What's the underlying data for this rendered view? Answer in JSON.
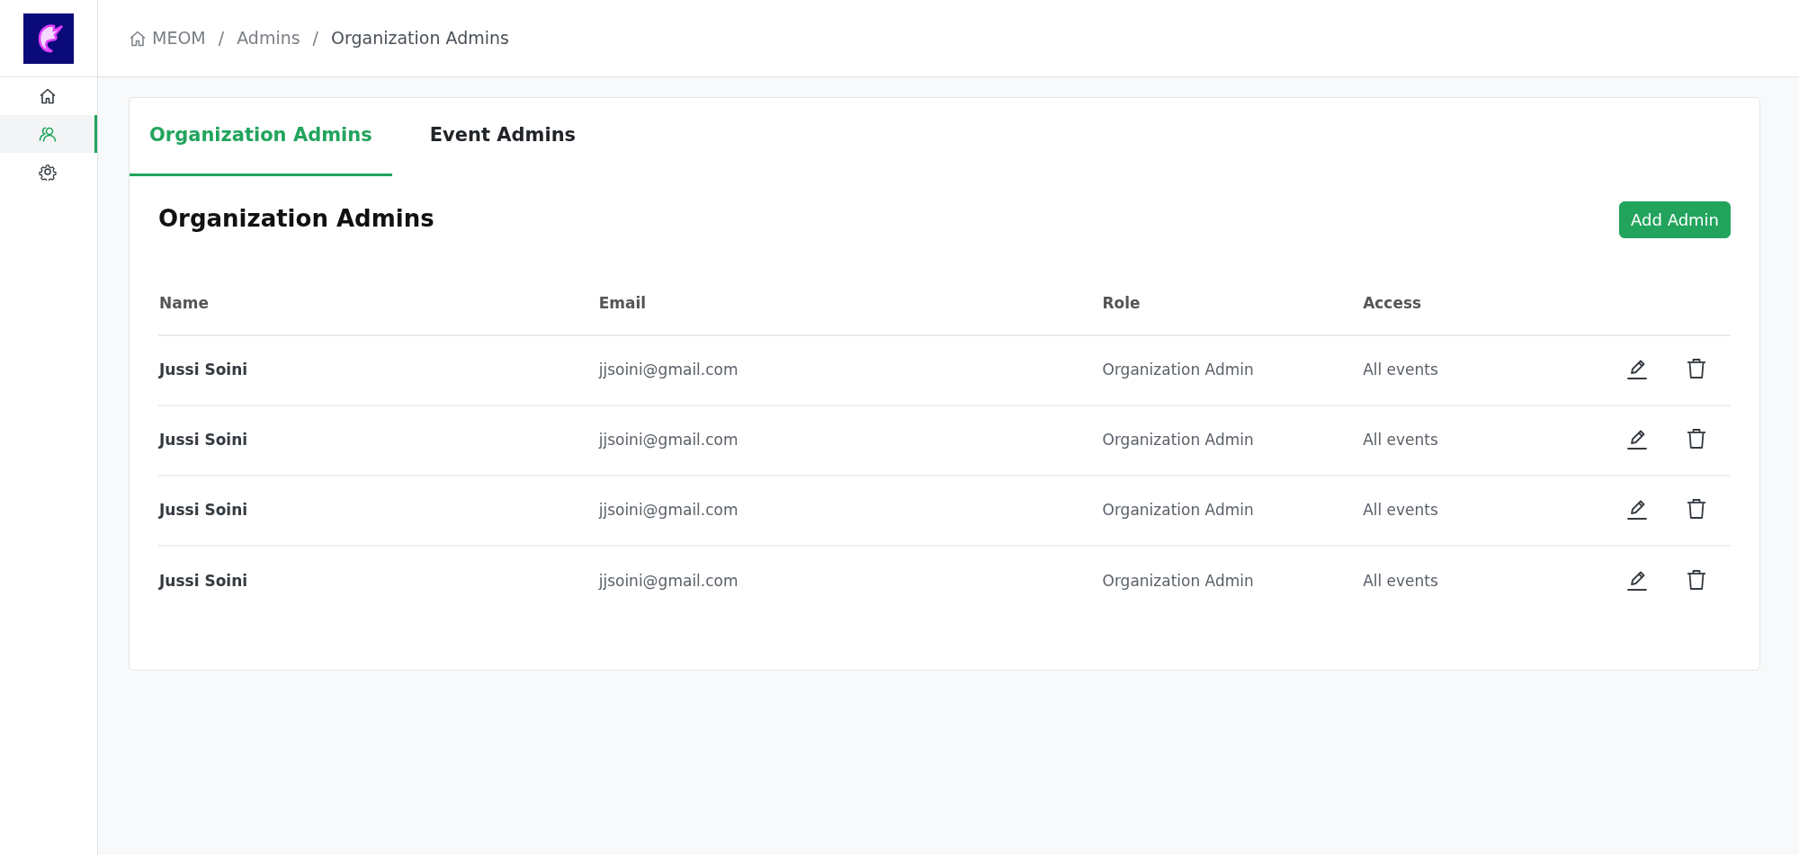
{
  "sidebar": {
    "items": [
      {
        "kind": "home",
        "selected": false
      },
      {
        "kind": "users",
        "selected": true
      },
      {
        "kind": "settings",
        "selected": false
      }
    ]
  },
  "breadcrumb": [
    {
      "label": "MEOM",
      "home": true
    },
    {
      "separator": "/",
      "label": "Admins",
      "home": false
    },
    {
      "separator": "/",
      "label": "Organization Admins",
      "home": false
    }
  ],
  "tabs": [
    {
      "label": "Organization Admins",
      "selected": true
    },
    {
      "label": "Event Admins",
      "selected": false
    }
  ],
  "section": {
    "title": "Organization Admins",
    "button": "Add Admin"
  },
  "table": {
    "columns": [
      "Name",
      "Email",
      "Role",
      "Access"
    ],
    "rows": [
      {
        "name": "Jussi Soini",
        "email": "jjsoini@gmail.com",
        "role": "Organization Admin",
        "access": "All events"
      },
      {
        "name": "Jussi Soini",
        "email": "jjsoini@gmail.com",
        "role": "Organization Admin",
        "access": "All events"
      },
      {
        "name": "Jussi Soini",
        "email": "jjsoini@gmail.com",
        "role": "Organization Admin",
        "access": "All events"
      },
      {
        "name": "Jussi Soini",
        "email": "jjsoini@gmail.com",
        "role": "Organization Admin",
        "access": "All events"
      }
    ]
  }
}
